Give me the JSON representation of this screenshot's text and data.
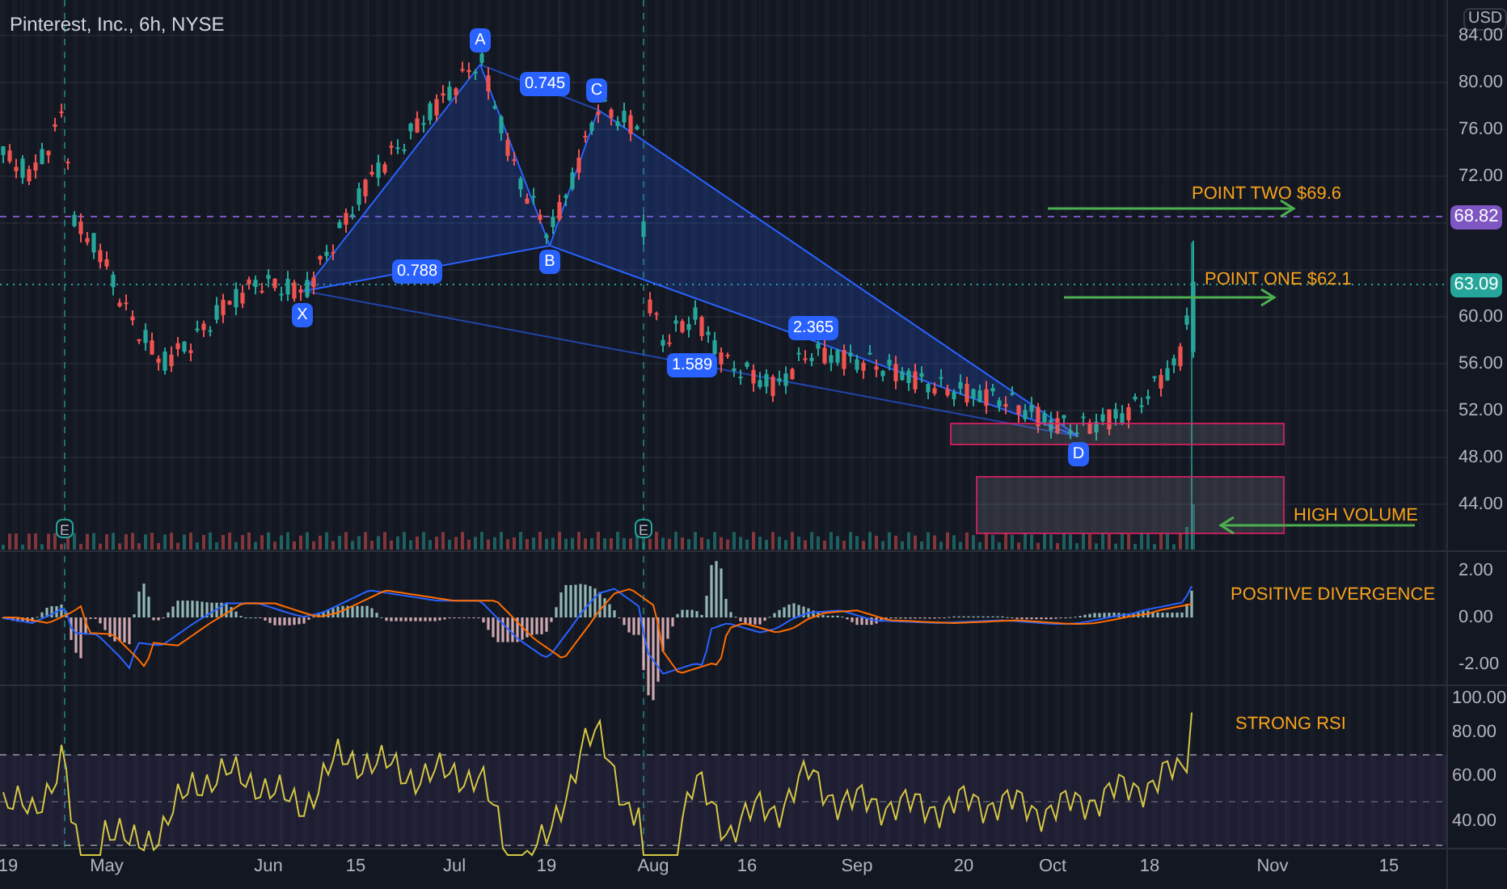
{
  "chart": {
    "title": "Pinterest, Inc., 6h, NYSE"
  },
  "price_axis": {
    "currency": "USD",
    "labels": [
      "84.00",
      "80.00",
      "76.00",
      "72.00",
      "60.00",
      "56.00",
      "52.00",
      "48.00",
      "44.00"
    ],
    "tags": [
      {
        "text": "68.82",
        "color": "#7e57c2"
      },
      {
        "text": "63.09",
        "color": "#26a69a"
      }
    ]
  },
  "pattern": {
    "points": [
      "X",
      "A",
      "B",
      "C",
      "D"
    ],
    "ratios": [
      "0.745",
      "0.788",
      "1.589",
      "2.365"
    ]
  },
  "annotations": [
    "POINT TWO $69.6",
    "POINT ONE $62.1",
    "HIGH VOLUME",
    "POSITIVE DIVERGENCE",
    "STRONG RSI"
  ],
  "earnings_markers": [
    "E",
    "E"
  ],
  "macd_axis": [
    "2.00",
    "0.00",
    "-2.00"
  ],
  "rsi_axis": [
    "100.00",
    "80.00",
    "60.00",
    "40.00"
  ],
  "time_axis": [
    "19",
    "May",
    "Jun",
    "15",
    "Jul",
    "19",
    "Aug",
    "16",
    "Sep",
    "20",
    "Oct",
    "18",
    "Nov",
    "15"
  ]
}
